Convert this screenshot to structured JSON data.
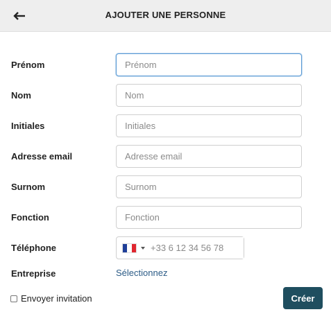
{
  "header": {
    "title": "AJOUTER UNE PERSONNE",
    "back_icon": "arrow-left-icon"
  },
  "form": {
    "first_name": {
      "label": "Prénom",
      "placeholder": "Prénom"
    },
    "last_name": {
      "label": "Nom",
      "placeholder": "Nom"
    },
    "initials": {
      "label": "Initiales",
      "placeholder": "Initiales"
    },
    "email": {
      "label": "Adresse email",
      "placeholder": "Adresse email"
    },
    "nickname": {
      "label": "Surnom",
      "placeholder": "Surnom"
    },
    "job": {
      "label": "Fonction",
      "placeholder": "Fonction"
    },
    "phone": {
      "label": "Téléphone",
      "placeholder": "+33 6 12 34 56 78",
      "country": "FR",
      "flag_icon": "france-flag-icon"
    },
    "company": {
      "label": "Entreprise",
      "link": "Sélectionnez"
    }
  },
  "footer": {
    "invite_label": "Envoyer invitation",
    "invite_checked": false,
    "create_label": "Créer"
  },
  "colors": {
    "header_bg": "#eeeeee",
    "primary_button": "#1f4e5f",
    "link": "#2b5b86",
    "focus_border": "#5b9bd5"
  }
}
